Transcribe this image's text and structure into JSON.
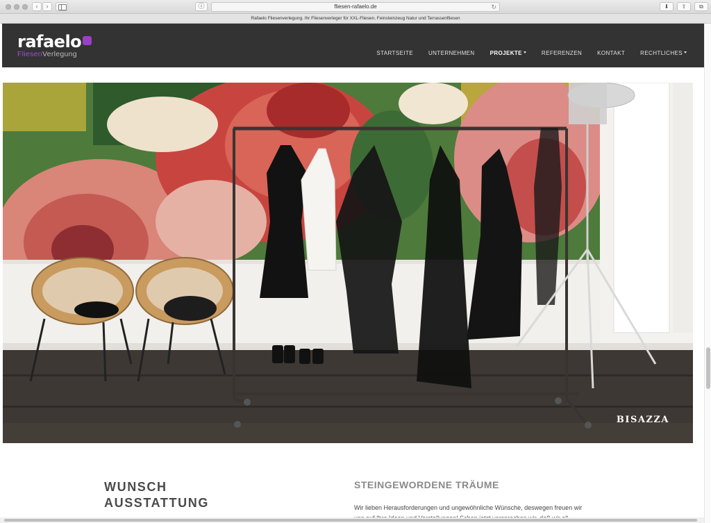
{
  "browser": {
    "url": "fliesen-rafaelo.de",
    "page_title": "Rafaelo Fliesenverlegung. Ihr Fliesenverleger für XXL-Fliesen, Feinsteinzeug Natur und Terrassenfliesen"
  },
  "logo": {
    "main": "rafaelo",
    "sub_a": "Fliesen",
    "sub_b": "Verlegung",
    "accent_color": "#9b3fc7"
  },
  "nav": {
    "items": [
      {
        "label": "STARTSEITE",
        "dropdown": false,
        "active": false
      },
      {
        "label": "UNTERNEHMEN",
        "dropdown": false,
        "active": false
      },
      {
        "label": "PROJEKTE",
        "dropdown": true,
        "active": true
      },
      {
        "label": "REFERENZEN",
        "dropdown": false,
        "active": false
      },
      {
        "label": "KONTAKT",
        "dropdown": false,
        "active": false
      },
      {
        "label": "RECHTLICHES",
        "dropdown": true,
        "active": false
      }
    ]
  },
  "hero": {
    "brand": "BISAZZA"
  },
  "content": {
    "left_title_line1": "WUNSCH",
    "left_title_line2": "AUSSTATTUNG",
    "right_title": "STEINGEWORDENE TRÄUME",
    "right_text": "Wir lieben Herausforderungen und ungewöhnliche Wünsche, deswegen freuen wir uns auf Ihre Ideen und Vorstellungen! Schon jetzt versprechen wir, daß wir all"
  },
  "colors": {
    "header_bg": "#333333",
    "accent": "#9b3fc7"
  }
}
